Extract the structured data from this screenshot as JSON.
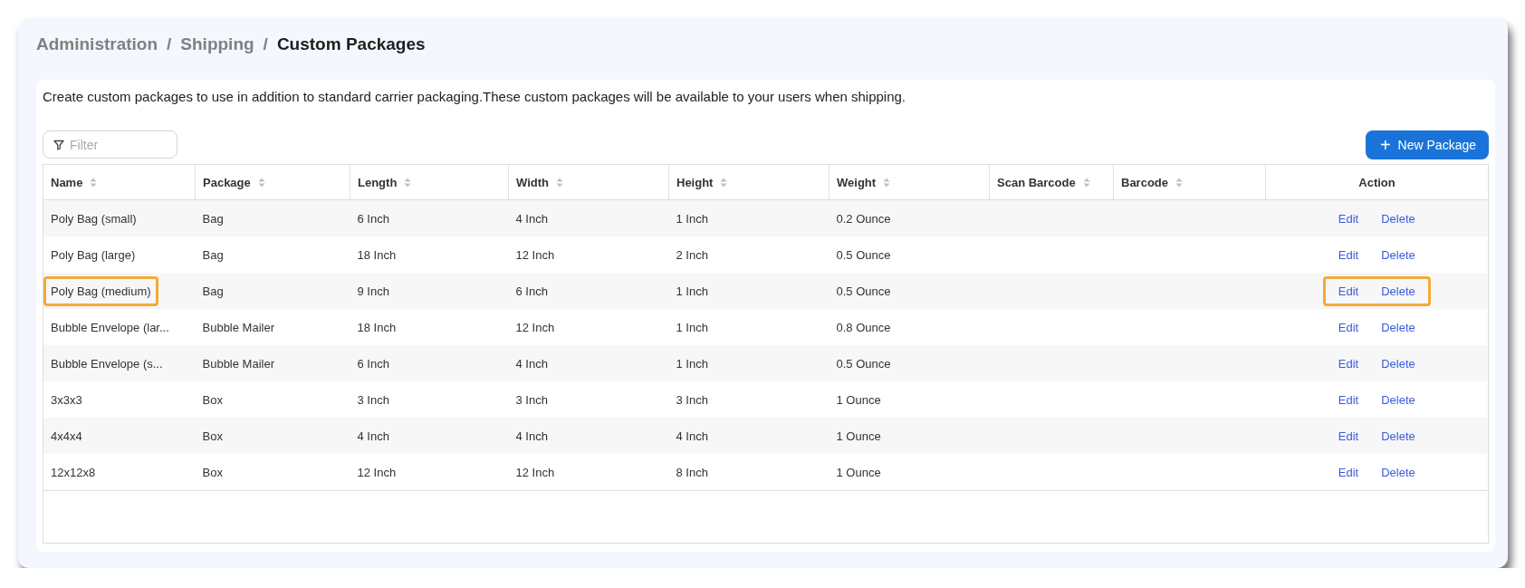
{
  "breadcrumb": [
    {
      "label": "Administration",
      "current": false
    },
    {
      "label": "Shipping",
      "current": false
    },
    {
      "label": "Custom Packages",
      "current": true
    }
  ],
  "separator": "/",
  "description": "Create custom packages to use in addition to standard carrier packaging.These custom packages will be available to your users when shipping.",
  "filter": {
    "placeholder": "Filter"
  },
  "new_button": {
    "icon": "+",
    "label": "New Package"
  },
  "table": {
    "columns": [
      {
        "label": "Name",
        "sortable": true
      },
      {
        "label": "Package",
        "sortable": true
      },
      {
        "label": "Length",
        "sortable": true
      },
      {
        "label": "Width",
        "sortable": true
      },
      {
        "label": "Height",
        "sortable": true
      },
      {
        "label": "Weight",
        "sortable": true
      },
      {
        "label": "Scan Barcode",
        "sortable": true
      },
      {
        "label": "Barcode",
        "sortable": true
      },
      {
        "label": "Action",
        "sortable": false
      }
    ],
    "rows": [
      {
        "cells": [
          "Poly Bag (small)",
          "Bag",
          "6 Inch",
          "4 Inch",
          "1 Inch",
          "0.2 Ounce",
          "",
          ""
        ],
        "actions": [
          "Edit",
          "Delete"
        ],
        "name_highlighted": false,
        "actions_highlighted": false
      },
      {
        "cells": [
          "Poly Bag (large)",
          "Bag",
          "18 Inch",
          "12 Inch",
          "2 Inch",
          "0.5 Ounce",
          "",
          ""
        ],
        "actions": [
          "Edit",
          "Delete"
        ],
        "name_highlighted": false,
        "actions_highlighted": false
      },
      {
        "cells": [
          "Poly Bag (medium)",
          "Bag",
          "9 Inch",
          "6 Inch",
          "1 Inch",
          "0.5 Ounce",
          "",
          ""
        ],
        "actions": [
          "Edit",
          "Delete"
        ],
        "name_highlighted": true,
        "actions_highlighted": true
      },
      {
        "cells": [
          "Bubble Envelope (lar...",
          "Bubble Mailer",
          "18 Inch",
          "12 Inch",
          "1 Inch",
          "0.8 Ounce",
          "",
          ""
        ],
        "actions": [
          "Edit",
          "Delete"
        ],
        "name_highlighted": false,
        "actions_highlighted": false
      },
      {
        "cells": [
          "Bubble Envelope (s...",
          "Bubble Mailer",
          "6 Inch",
          "4 Inch",
          "1 Inch",
          "0.5 Ounce",
          "",
          ""
        ],
        "actions": [
          "Edit",
          "Delete"
        ],
        "name_highlighted": false,
        "actions_highlighted": false
      },
      {
        "cells": [
          "3x3x3",
          "Box",
          "3 Inch",
          "3 Inch",
          "3 Inch",
          "1 Ounce",
          "",
          ""
        ],
        "actions": [
          "Edit",
          "Delete"
        ],
        "name_highlighted": false,
        "actions_highlighted": false
      },
      {
        "cells": [
          "4x4x4",
          "Box",
          "4 Inch",
          "4 Inch",
          "4 Inch",
          "1 Ounce",
          "",
          ""
        ],
        "actions": [
          "Edit",
          "Delete"
        ],
        "name_highlighted": false,
        "actions_highlighted": false
      },
      {
        "cells": [
          "12x12x8",
          "Box",
          "12 Inch",
          "12 Inch",
          "8 Inch",
          "1 Ounce",
          "",
          ""
        ],
        "actions": [
          "Edit",
          "Delete"
        ],
        "name_highlighted": false,
        "actions_highlighted": false
      }
    ]
  }
}
